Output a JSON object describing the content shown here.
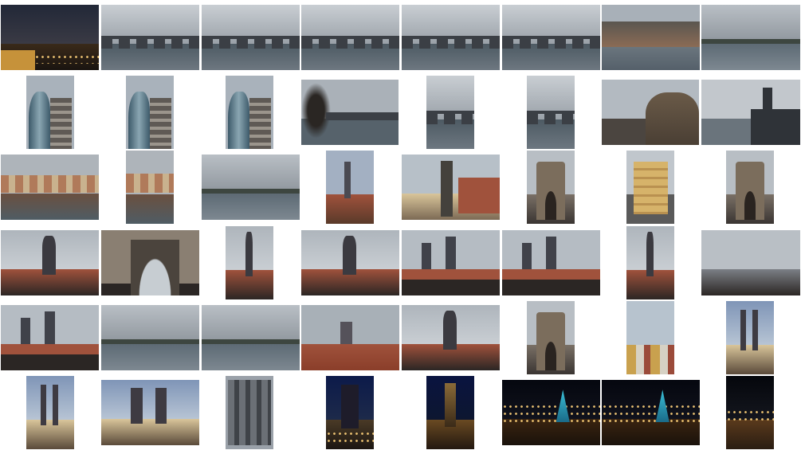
{
  "gallery": {
    "theme_colors": {
      "overcast_sky": "#9aa1a8",
      "river": "#4d5a63",
      "stone": "#3b3f45",
      "night_sky": "#0d1630",
      "dusk_sky": "#1d2a4a",
      "festive_light": "#ffd27a",
      "crowd": "#2b2624",
      "facade_red": "#a0523c",
      "facade_cream": "#d9c59a"
    },
    "thumbnails": [
      {
        "scene": "night-river"
      },
      {
        "scene": "overcast-bridge"
      },
      {
        "scene": "overcast-bridge"
      },
      {
        "scene": "overcast-bridge"
      },
      {
        "scene": "overcast-bridge"
      },
      {
        "scene": "overcast-bridge"
      },
      {
        "scene": "castle-hill"
      },
      {
        "scene": "overcast-river"
      },
      {
        "scene": "dancing-house"
      },
      {
        "scene": "dancing-house"
      },
      {
        "scene": "dancing-house"
      },
      {
        "scene": "tree-bridge"
      },
      {
        "scene": "overcast-bridge"
      },
      {
        "scene": "overcast-bridge"
      },
      {
        "scene": "domed-building"
      },
      {
        "scene": "bridge-tower"
      },
      {
        "scene": "riverbank-town"
      },
      {
        "scene": "riverbank-town"
      },
      {
        "scene": "overcast-river"
      },
      {
        "scene": "towers-street"
      },
      {
        "scene": "statue-street"
      },
      {
        "scene": "gothic-gate"
      },
      {
        "scene": "yellow-building"
      },
      {
        "scene": "gothic-gate"
      },
      {
        "scene": "tower-crowd"
      },
      {
        "scene": "archway"
      },
      {
        "scene": "tower-crowd"
      },
      {
        "scene": "tower-crowd"
      },
      {
        "scene": "crowd-rooftops"
      },
      {
        "scene": "crowd-rooftops"
      },
      {
        "scene": "tower-crowd"
      },
      {
        "scene": "crowd-wide"
      },
      {
        "scene": "crowd-rooftops"
      },
      {
        "scene": "overcast-river"
      },
      {
        "scene": "overcast-river"
      },
      {
        "scene": "red-roofs"
      },
      {
        "scene": "tower-crowd"
      },
      {
        "scene": "gothic-gate"
      },
      {
        "scene": "colorful-buildings"
      },
      {
        "scene": "tyn-church"
      },
      {
        "scene": "tyn-church"
      },
      {
        "scene": "tyn-church"
      },
      {
        "scene": "facade"
      },
      {
        "scene": "night-church"
      },
      {
        "scene": "night-tower"
      },
      {
        "scene": "christmas-market"
      },
      {
        "scene": "christmas-market"
      },
      {
        "scene": "night-square"
      }
    ]
  }
}
